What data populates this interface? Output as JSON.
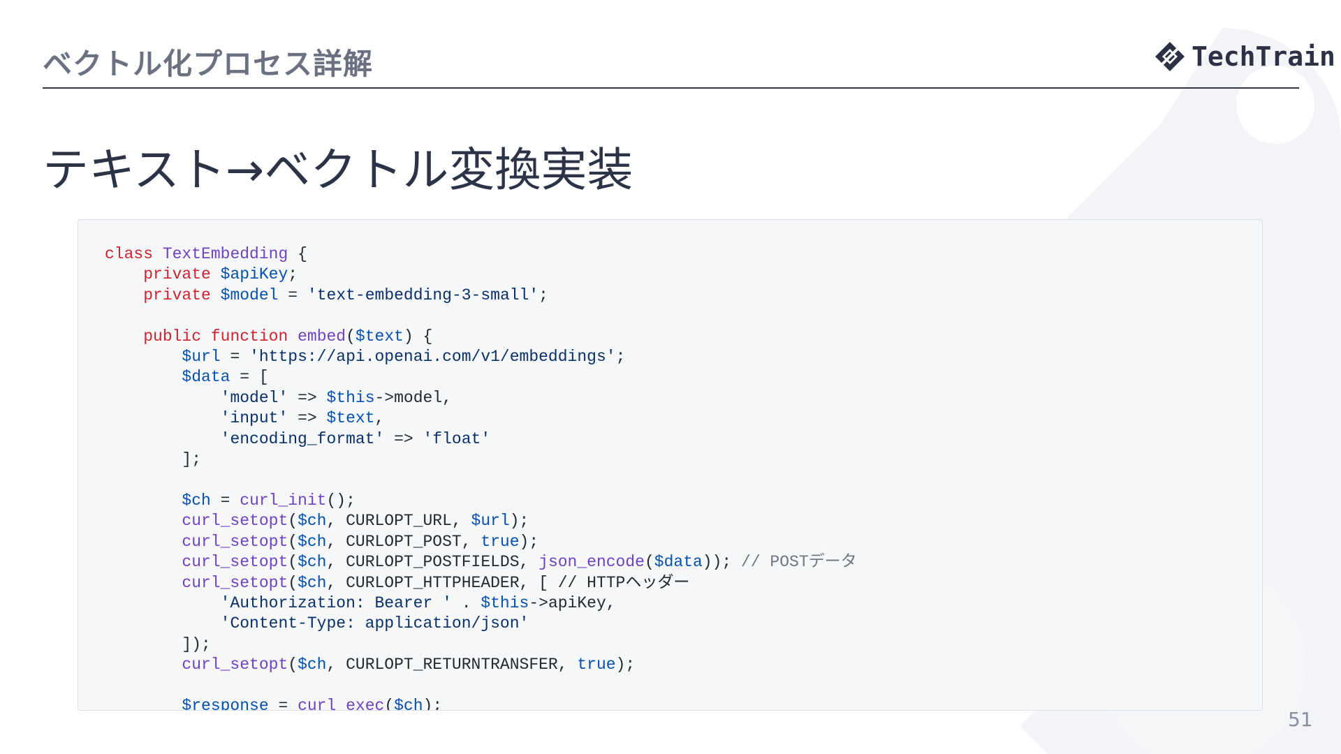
{
  "header": {
    "title": "ベクトル化プロセス詳解",
    "logo_text": "TechTrain"
  },
  "slide": {
    "title": "テキスト→ベクトル変換実装",
    "page_number": "51"
  },
  "code": {
    "lines": [
      [
        {
          "t": "class",
          "k": "kw"
        },
        {
          "t": " ",
          "k": "plain"
        },
        {
          "t": "TextEmbedding",
          "k": "cls"
        },
        {
          "t": " {",
          "k": "plain"
        }
      ],
      [
        {
          "t": "    ",
          "k": "plain"
        },
        {
          "t": "private",
          "k": "kw"
        },
        {
          "t": " ",
          "k": "plain"
        },
        {
          "t": "$apiKey",
          "k": "var"
        },
        {
          "t": ";",
          "k": "plain"
        }
      ],
      [
        {
          "t": "    ",
          "k": "plain"
        },
        {
          "t": "private",
          "k": "kw"
        },
        {
          "t": " ",
          "k": "plain"
        },
        {
          "t": "$model",
          "k": "var"
        },
        {
          "t": " = ",
          "k": "plain"
        },
        {
          "t": "'text-embedding-3-small'",
          "k": "str"
        },
        {
          "t": ";",
          "k": "plain"
        }
      ],
      [],
      [
        {
          "t": "    ",
          "k": "plain"
        },
        {
          "t": "public",
          "k": "kw"
        },
        {
          "t": " ",
          "k": "plain"
        },
        {
          "t": "function",
          "k": "kw"
        },
        {
          "t": " ",
          "k": "plain"
        },
        {
          "t": "embed",
          "k": "fn"
        },
        {
          "t": "(",
          "k": "plain"
        },
        {
          "t": "$text",
          "k": "var"
        },
        {
          "t": ") {",
          "k": "plain"
        }
      ],
      [
        {
          "t": "        ",
          "k": "plain"
        },
        {
          "t": "$url",
          "k": "var"
        },
        {
          "t": " = ",
          "k": "plain"
        },
        {
          "t": "'https://api.openai.com/v1/embeddings'",
          "k": "str"
        },
        {
          "t": ";",
          "k": "plain"
        }
      ],
      [
        {
          "t": "        ",
          "k": "plain"
        },
        {
          "t": "$data",
          "k": "var"
        },
        {
          "t": " = [",
          "k": "plain"
        }
      ],
      [
        {
          "t": "            ",
          "k": "plain"
        },
        {
          "t": "'model'",
          "k": "str"
        },
        {
          "t": " => ",
          "k": "plain"
        },
        {
          "t": "$this",
          "k": "var"
        },
        {
          "t": "->model,",
          "k": "plain"
        }
      ],
      [
        {
          "t": "            ",
          "k": "plain"
        },
        {
          "t": "'input'",
          "k": "str"
        },
        {
          "t": " => ",
          "k": "plain"
        },
        {
          "t": "$text",
          "k": "var"
        },
        {
          "t": ",",
          "k": "plain"
        }
      ],
      [
        {
          "t": "            ",
          "k": "plain"
        },
        {
          "t": "'encoding_format'",
          "k": "str"
        },
        {
          "t": " => ",
          "k": "plain"
        },
        {
          "t": "'float'",
          "k": "str"
        }
      ],
      [
        {
          "t": "        ];",
          "k": "plain"
        }
      ],
      [],
      [
        {
          "t": "        ",
          "k": "plain"
        },
        {
          "t": "$ch",
          "k": "var"
        },
        {
          "t": " = ",
          "k": "plain"
        },
        {
          "t": "curl_init",
          "k": "fn"
        },
        {
          "t": "();",
          "k": "plain"
        }
      ],
      [
        {
          "t": "        ",
          "k": "plain"
        },
        {
          "t": "curl_setopt",
          "k": "fn"
        },
        {
          "t": "(",
          "k": "plain"
        },
        {
          "t": "$ch",
          "k": "var"
        },
        {
          "t": ", CURLOPT_URL, ",
          "k": "plain"
        },
        {
          "t": "$url",
          "k": "var"
        },
        {
          "t": ");",
          "k": "plain"
        }
      ],
      [
        {
          "t": "        ",
          "k": "plain"
        },
        {
          "t": "curl_setopt",
          "k": "fn"
        },
        {
          "t": "(",
          "k": "plain"
        },
        {
          "t": "$ch",
          "k": "var"
        },
        {
          "t": ", CURLOPT_POST, ",
          "k": "plain"
        },
        {
          "t": "true",
          "k": "bool"
        },
        {
          "t": ");",
          "k": "plain"
        }
      ],
      [
        {
          "t": "        ",
          "k": "plain"
        },
        {
          "t": "curl_setopt",
          "k": "fn"
        },
        {
          "t": "(",
          "k": "plain"
        },
        {
          "t": "$ch",
          "k": "var"
        },
        {
          "t": ", CURLOPT_POSTFIELDS, ",
          "k": "plain"
        },
        {
          "t": "json_encode",
          "k": "fn"
        },
        {
          "t": "(",
          "k": "plain"
        },
        {
          "t": "$data",
          "k": "var"
        },
        {
          "t": ")); ",
          "k": "plain"
        },
        {
          "t": "// POSTデータ",
          "k": "cmt"
        }
      ],
      [
        {
          "t": "        ",
          "k": "plain"
        },
        {
          "t": "curl_setopt",
          "k": "fn"
        },
        {
          "t": "(",
          "k": "plain"
        },
        {
          "t": "$ch",
          "k": "var"
        },
        {
          "t": ", CURLOPT_HTTPHEADER, [ // HTTPヘッダー",
          "k": "plain"
        }
      ],
      [
        {
          "t": "            ",
          "k": "plain"
        },
        {
          "t": "'Authorization: Bearer '",
          "k": "str"
        },
        {
          "t": " . ",
          "k": "plain"
        },
        {
          "t": "$this",
          "k": "var"
        },
        {
          "t": "->apiKey,",
          "k": "plain"
        }
      ],
      [
        {
          "t": "            ",
          "k": "plain"
        },
        {
          "t": "'Content-Type: application/json'",
          "k": "str"
        }
      ],
      [
        {
          "t": "        ]);",
          "k": "plain"
        }
      ],
      [
        {
          "t": "        ",
          "k": "plain"
        },
        {
          "t": "curl_setopt",
          "k": "fn"
        },
        {
          "t": "(",
          "k": "plain"
        },
        {
          "t": "$ch",
          "k": "var"
        },
        {
          "t": ", CURLOPT_RETURNTRANSFER, ",
          "k": "plain"
        },
        {
          "t": "true",
          "k": "bool"
        },
        {
          "t": ");",
          "k": "plain"
        }
      ],
      [],
      [
        {
          "t": "        ",
          "k": "plain"
        },
        {
          "t": "$response",
          "k": "var"
        },
        {
          "t": " = ",
          "k": "plain"
        },
        {
          "t": "curl_exec",
          "k": "fn"
        },
        {
          "t": "(",
          "k": "plain"
        },
        {
          "t": "$ch",
          "k": "var"
        },
        {
          "t": ");",
          "k": "plain"
        }
      ]
    ]
  },
  "colors": {
    "accent": "#2f3448",
    "keyword": "#cf222e",
    "function": "#6f42c1",
    "variable": "#0550ae",
    "string": "#0a3069",
    "comment": "#6e7781",
    "code_background": "#f6f7f9"
  },
  "icons": {
    "logo": "techtrain-diamond-logo-icon"
  }
}
